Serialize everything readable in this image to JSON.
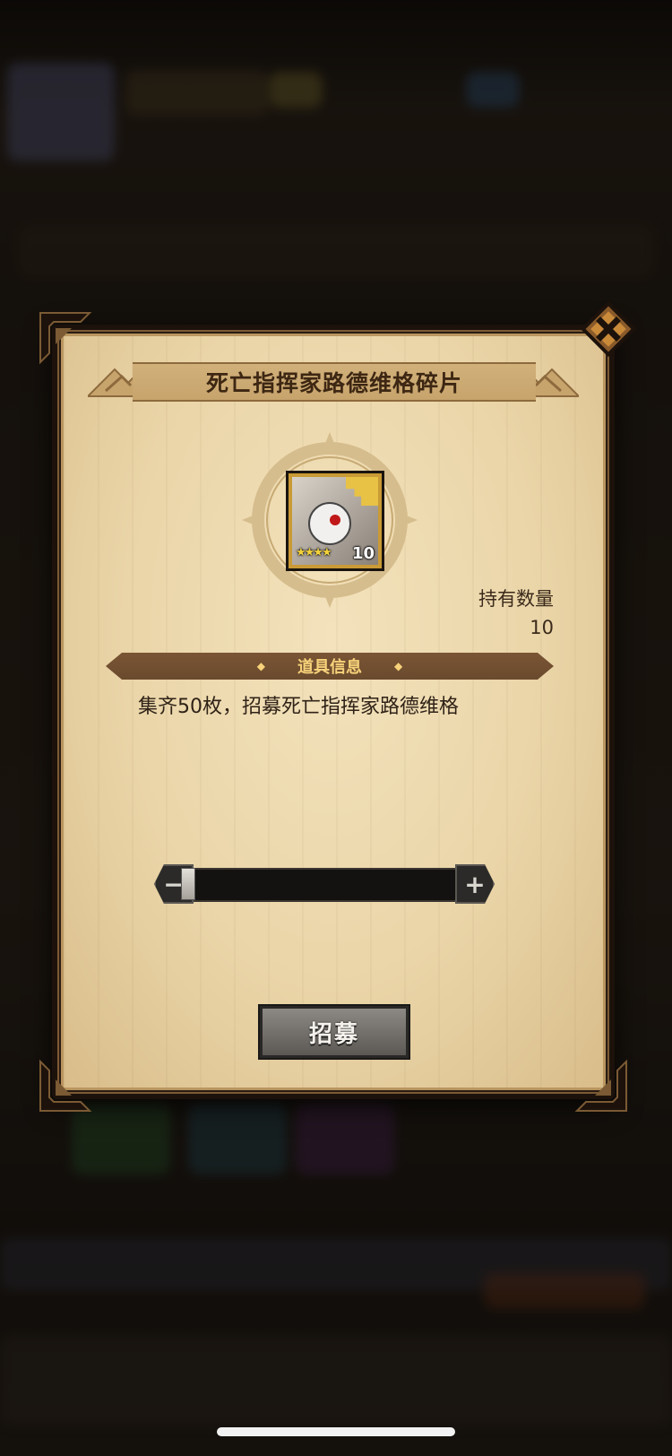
{
  "dialog": {
    "title": "死亡指挥家路德维格碎片",
    "item": {
      "icon": "skull-jester-puzzle-icon",
      "stars": "★★★★",
      "card_count": "10"
    },
    "hold_label": "持有数量",
    "hold_value": "10",
    "info_header": "道具信息",
    "description": "集齐50枚，招募死亡指挥家路德维格",
    "slider": {
      "level": 0,
      "minus_label": "−",
      "plus_label": "+"
    },
    "recruit_label": "招募"
  },
  "colors": {
    "paper": "#ead5a8",
    "banner": "#6a4a2d",
    "accent": "#f7d27a",
    "frame": "#1c120b"
  }
}
